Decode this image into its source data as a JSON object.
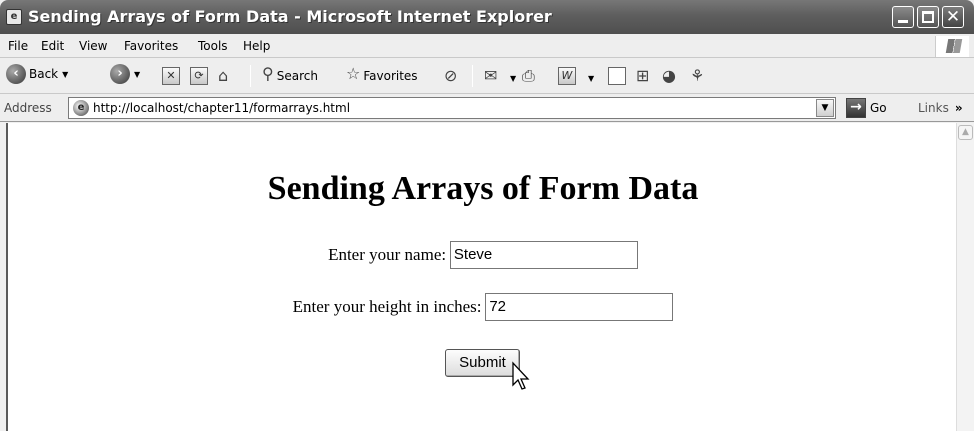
{
  "window": {
    "title": "Sending Arrays of Form Data - Microsoft Internet Explorer"
  },
  "menu": {
    "items": [
      "File",
      "Edit",
      "View",
      "Favorites",
      "Tools",
      "Help"
    ]
  },
  "toolbar": {
    "back_label": "Back",
    "search_label": "Search",
    "favorites_label": "Favorites"
  },
  "address": {
    "label": "Address",
    "url": "http://localhost/chapter11/formarrays.html",
    "go_label": "Go",
    "links_label": "Links"
  },
  "page": {
    "heading": "Sending Arrays of Form Data",
    "name_label": "Enter your name:",
    "name_value": "Steve",
    "height_label": "Enter your height in inches:",
    "height_value": "72",
    "submit_label": "Submit"
  },
  "icons": {
    "back": "back-arrow-icon",
    "forward": "forward-arrow-icon",
    "stop": "stop-icon",
    "refresh": "refresh-icon",
    "home": "home-icon",
    "search": "search-icon",
    "favorites": "star-icon",
    "media": "media-icon",
    "mail": "mail-icon",
    "print": "printer-icon",
    "edit": "word-icon",
    "discuss": "discuss-icon",
    "research": "research-icon",
    "messenger": "messenger-icon",
    "page": "ie-page-icon",
    "go": "go-arrow-icon",
    "cursor": "mouse-pointer-icon"
  }
}
